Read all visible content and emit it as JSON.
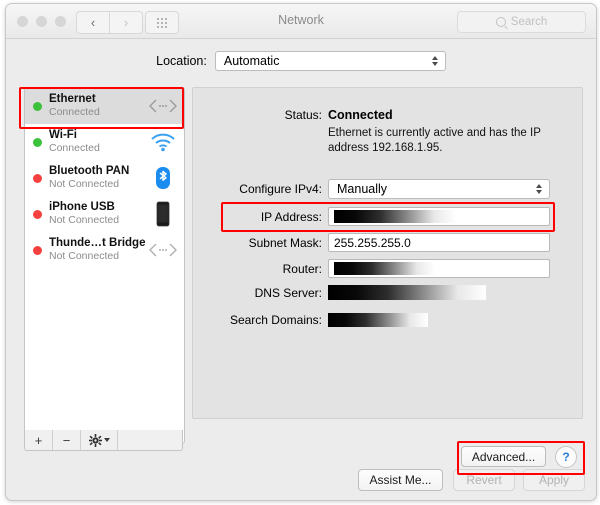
{
  "window": {
    "title": "Network",
    "search_placeholder": "Search",
    "traffic_lights": [
      "close",
      "minimize",
      "zoom"
    ],
    "nav": {
      "back": "‹",
      "forward": "›"
    },
    "grid_button": "show-all"
  },
  "location": {
    "label": "Location:",
    "value": "Automatic"
  },
  "sidebar": {
    "services": [
      {
        "name": "Ethernet",
        "status": "Connected",
        "dot": "green",
        "icon": "ethernet-icon",
        "selected": true
      },
      {
        "name": "Wi-Fi",
        "status": "Connected",
        "dot": "green",
        "icon": "wifi-icon",
        "selected": false
      },
      {
        "name": "Bluetooth PAN",
        "status": "Not Connected",
        "dot": "red",
        "icon": "bluetooth-icon",
        "selected": false
      },
      {
        "name": "iPhone USB",
        "status": "Not Connected",
        "dot": "red",
        "icon": "iphone-icon",
        "selected": false
      },
      {
        "name": "Thunde…t Bridge",
        "status": "Not Connected",
        "dot": "red",
        "icon": "ethernet-icon",
        "selected": false
      }
    ],
    "footer": {
      "add": "+",
      "remove": "−",
      "actions": "gear"
    }
  },
  "detail": {
    "status_label": "Status:",
    "status_value": "Connected",
    "status_description": "Ethernet is currently active and has the IP address 192.168.1.95.",
    "configure_label": "Configure IPv4:",
    "configure_value": "Manually",
    "fields": [
      {
        "label": "IP Address:",
        "value": "",
        "redacted": true,
        "bordered": true
      },
      {
        "label": "Subnet Mask:",
        "value": "255.255.255.0",
        "redacted": false,
        "bordered": true
      },
      {
        "label": "Router:",
        "value": "",
        "redacted": true,
        "bordered": true
      },
      {
        "label": "DNS Server:",
        "value": "",
        "redacted": true,
        "bordered": false
      },
      {
        "label": "Search Domains:",
        "value": "",
        "redacted": true,
        "bordered": false
      }
    ],
    "advanced_button": "Advanced...",
    "help_button": "?"
  },
  "footer": {
    "assist": "Assist Me...",
    "revert": "Revert",
    "apply": "Apply"
  },
  "annotations": {
    "color": "#ff0000",
    "count": 3
  }
}
